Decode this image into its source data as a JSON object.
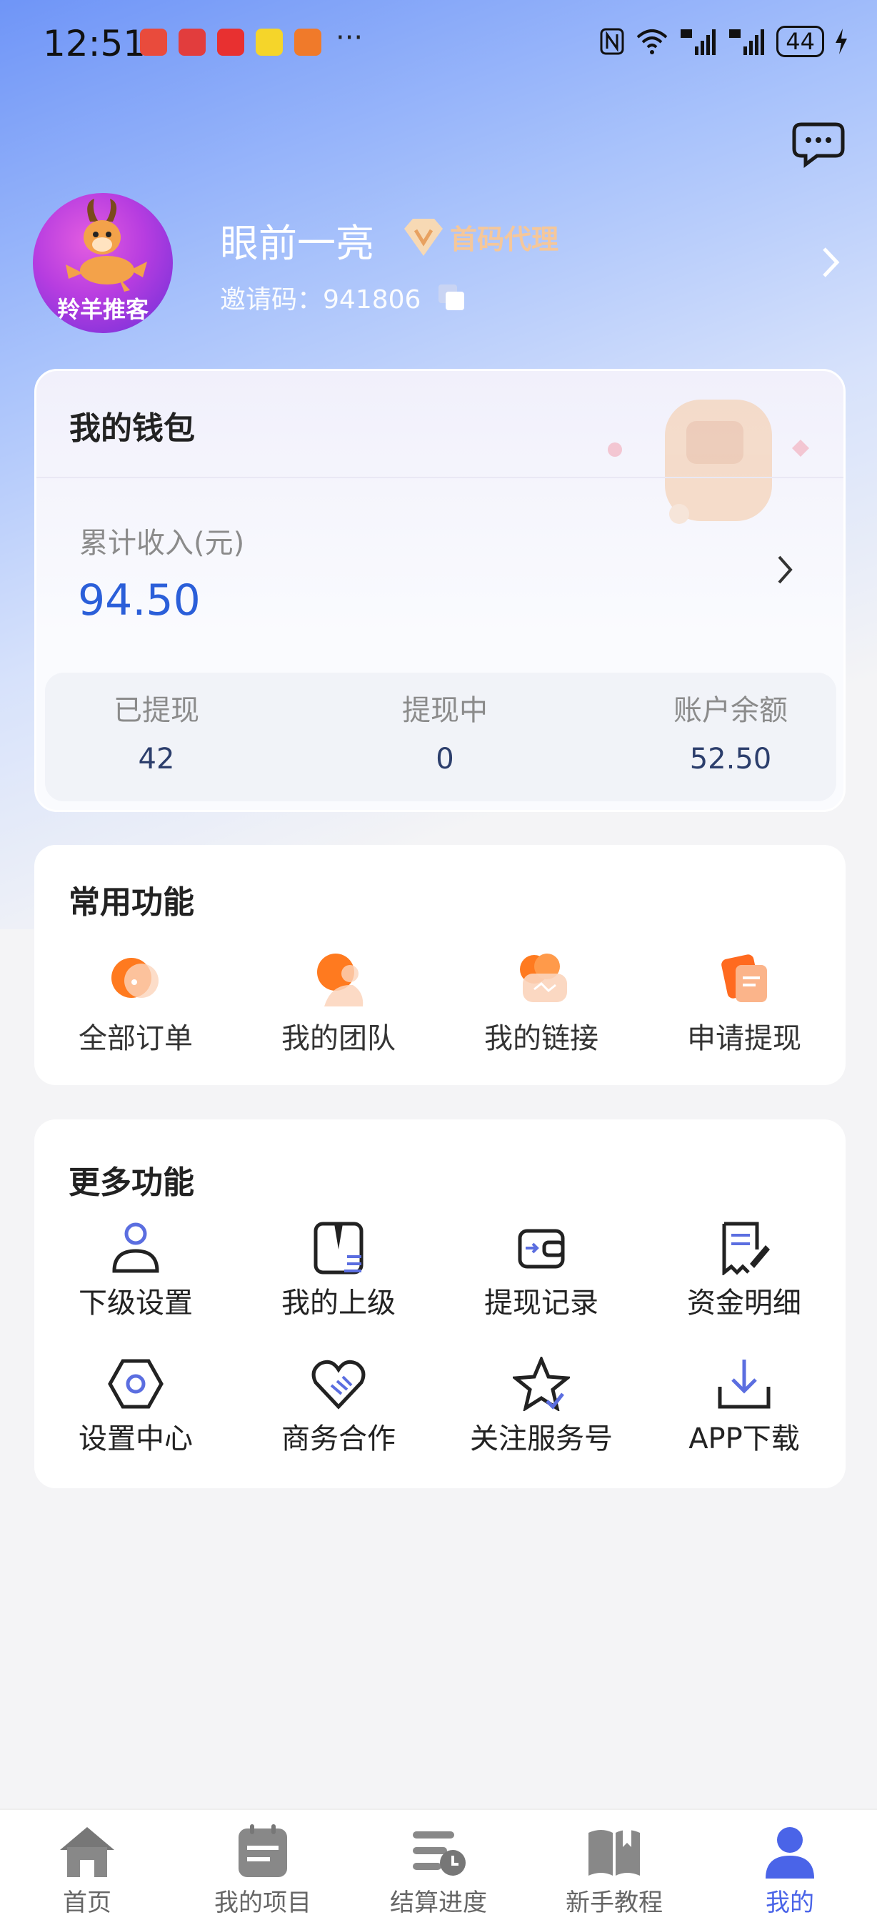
{
  "status_bar": {
    "time": "12:51",
    "dots": "···",
    "battery": "44"
  },
  "profile": {
    "avatar_text": "羚羊推客",
    "name": "眼前一亮",
    "badge": "首码代理",
    "invite_label": "邀请码：",
    "invite_code": "941806"
  },
  "wallet": {
    "title": "我的钱包",
    "income_label": "累计收入(元)",
    "income_value": "94.50",
    "stats": [
      {
        "label": "已提现",
        "value": "42"
      },
      {
        "label": "提现中",
        "value": "0"
      },
      {
        "label": "账户余额",
        "value": "52.50"
      }
    ]
  },
  "common_functions": {
    "title": "常用功能",
    "items": [
      {
        "label": "全部订单",
        "icon": "orders-icon"
      },
      {
        "label": "我的团队",
        "icon": "team-icon"
      },
      {
        "label": "我的链接",
        "icon": "link-icon"
      },
      {
        "label": "申请提现",
        "icon": "withdraw-icon"
      }
    ]
  },
  "more_functions": {
    "title": "更多功能",
    "items": [
      {
        "label": "下级设置",
        "icon": "user-icon"
      },
      {
        "label": "我的上级",
        "icon": "superior-icon"
      },
      {
        "label": "提现记录",
        "icon": "wallet-icon"
      },
      {
        "label": "资金明细",
        "icon": "document-edit-icon"
      },
      {
        "label": "设置中心",
        "icon": "hexagon-settings-icon"
      },
      {
        "label": "商务合作",
        "icon": "handshake-heart-icon"
      },
      {
        "label": "关注服务号",
        "icon": "star-check-icon"
      },
      {
        "label": "APP下载",
        "icon": "download-icon"
      }
    ]
  },
  "tabbar": {
    "items": [
      {
        "label": "首页",
        "icon": "home-icon"
      },
      {
        "label": "我的项目",
        "icon": "project-icon"
      },
      {
        "label": "结算进度",
        "icon": "progress-icon"
      },
      {
        "label": "新手教程",
        "icon": "book-icon"
      },
      {
        "label": "我的",
        "icon": "profile-icon"
      }
    ],
    "active": "我的"
  },
  "colors": {
    "accent_blue": "#2b5fd9",
    "tab_active": "#4a64e8",
    "orange": "#ff7a1f",
    "badge_gold": "#f5c79a"
  }
}
